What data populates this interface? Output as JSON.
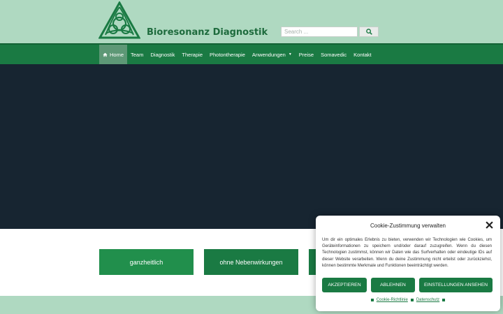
{
  "header": {
    "site_title": "Bioresonanz Diagnostik",
    "logo_icon": "celtic-triangle-knot-icon",
    "search": {
      "placeholder": "Search ...",
      "button_icon": "search-icon"
    }
  },
  "nav": {
    "items": [
      {
        "label": "Home",
        "icon": "home-icon",
        "active": true
      },
      {
        "label": "Team"
      },
      {
        "label": "Diagnostik"
      },
      {
        "label": "Therapie"
      },
      {
        "label": "Photontherapie"
      },
      {
        "label": "Anwendungen",
        "icon": "caret-down-icon"
      },
      {
        "label": "Preise"
      },
      {
        "label": "Somavedic"
      },
      {
        "label": "Kontakt"
      }
    ]
  },
  "features": [
    {
      "label": "ganzheitlich"
    },
    {
      "label": "ohne Nebenwirkungen"
    }
  ],
  "cookie": {
    "title": "Cookie-Zustimmung verwalten",
    "text": "Um dir ein optimales Erlebnis zu bieten, verwenden wir Technologien wie Cookies, um Geräteinformationen zu speichern und/oder darauf zuzugreifen. Wenn du diesen Technologien zustimmst, können wir Daten wie das Surfverhalten oder eindeutige IDs auf dieser Website verarbeiten. Wenn du deine Zustimmung nicht erteilst oder zurückziehst, können bestimmte Merkmale und Funktionen beeinträchtigt werden.",
    "accept": "AKZEPTIEREN",
    "deny": "ABLEHNEN",
    "preferences": "EINSTELLUNGEN ANSEHEN",
    "links": {
      "policy": "Cookie-Richtlinie",
      "privacy": "Datenschutz"
    }
  },
  "colors": {
    "header_bg": "#afd9c1",
    "nav_bg": "#1a7a43",
    "nav_active": "#5d9876",
    "hero_bg": "#172531",
    "accent": "#1a7a43"
  }
}
